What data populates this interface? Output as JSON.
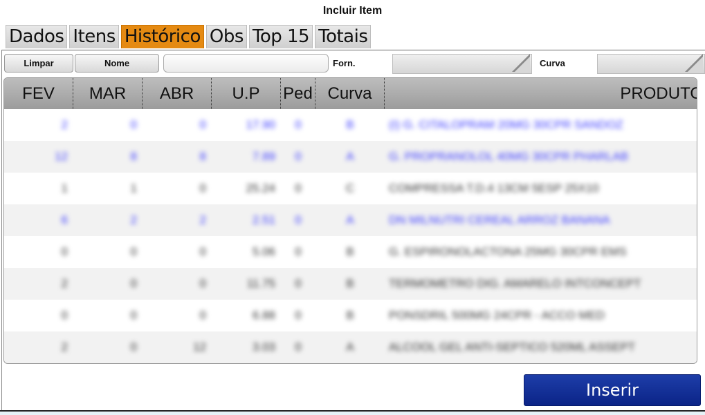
{
  "title": "Incluir Item",
  "tabs": [
    {
      "label": "Dados",
      "active": false
    },
    {
      "label": "Itens",
      "active": false
    },
    {
      "label": "Histórico",
      "active": true
    },
    {
      "label": "Obs",
      "active": false
    },
    {
      "label": "Top 15",
      "active": false
    },
    {
      "label": "Totais",
      "active": false
    }
  ],
  "toolbar": {
    "clear_label": "Limpar",
    "name_label": "Nome",
    "search_value": "",
    "supplier_label": "Forn.",
    "supplier_value": "",
    "curve_label": "Curva",
    "curve_value": ""
  },
  "table": {
    "columns": [
      "FEV",
      "MAR",
      "ABR",
      "U.P",
      "Ped",
      "Curva",
      "PRODUTO"
    ],
    "rows": [
      {
        "style": "blue",
        "cells": [
          "2",
          "0",
          "0",
          "17.90",
          "0",
          "B",
          "(I) G. CITALOPRAM 20MG 30CPR SANDOZ"
        ]
      },
      {
        "style": "blue",
        "cells": [
          "12",
          "8",
          "8",
          "7.89",
          "0",
          "A",
          "G. PROPRANOLOL 40MG 30CPR PHARLAB"
        ]
      },
      {
        "style": "gray",
        "cells": [
          "1",
          "1",
          "0",
          "25.24",
          "0",
          "C",
          "COMPRESSA T.D.4 13CM 5ESP 25X10"
        ]
      },
      {
        "style": "blue",
        "cells": [
          "6",
          "2",
          "2",
          "2.51",
          "0",
          "A",
          "DN MILNUTRI CEREAL ARROZ BANANA"
        ]
      },
      {
        "style": "gray",
        "cells": [
          "0",
          "0",
          "0",
          "5.06",
          "0",
          "B",
          "G. ESPIRONOLACTONA 25MG 30CPR EMS"
        ]
      },
      {
        "style": "gray",
        "cells": [
          "2",
          "0",
          "0",
          "11.75",
          "0",
          "B",
          "TERMOMETRO DIG. AMARELO INTCONCEPT"
        ]
      },
      {
        "style": "gray",
        "cells": [
          "0",
          "0",
          "0",
          "6.88",
          "0",
          "B",
          "PONSDRIL 500MG 24CPR - ACCO MED"
        ]
      },
      {
        "style": "gray",
        "cells": [
          "2",
          "0",
          "12",
          "3.03",
          "0",
          "A",
          "ALCOOL GEL ANTI-SEPTICO 520ML ASSEPT"
        ]
      }
    ]
  },
  "insert_label": "Inserir",
  "colors": {
    "active_tab": "#e58a12",
    "insert_button": "#0b2487",
    "blue_text": "#3b3bff"
  }
}
